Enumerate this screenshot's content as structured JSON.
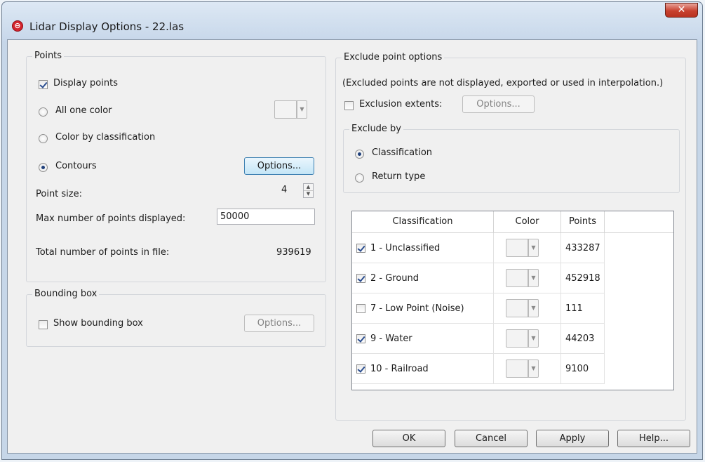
{
  "window": {
    "title": "Lidar Display Options - 22.las",
    "close_label": "✕"
  },
  "points": {
    "group_title": "Points",
    "display_points_label": "Display points",
    "display_points_checked": true,
    "all_one_color_label": "All one color",
    "color_by_classification_label": "Color by classification",
    "contours_label": "Contours",
    "selected_mode": "contours",
    "options_button_label": "Options...",
    "point_size_label": "Point size:",
    "point_size_value": "4",
    "max_points_label": "Max number of points displayed:",
    "max_points_value": "50000",
    "total_points_label": "Total number of points in file:",
    "total_points_value": "939619"
  },
  "bounding_box": {
    "group_title": "Bounding box",
    "show_label": "Show bounding box",
    "show_checked": false,
    "options_button_label": "Options..."
  },
  "exclude": {
    "group_title": "Exclude point options",
    "note": "(Excluded points are not displayed, exported or used in interpolation.)",
    "extents_label": "Exclusion extents:",
    "extents_checked": false,
    "extents_options_label": "Options...",
    "exclude_by_title": "Exclude by",
    "by_classification_label": "Classification",
    "by_return_type_label": "Return type",
    "selected_by": "classification"
  },
  "table": {
    "columns": [
      "Classification",
      "Color",
      "Points"
    ],
    "rows": [
      {
        "label": "1 - Unclassified",
        "checked": true,
        "points": "433287"
      },
      {
        "label": "2 - Ground",
        "checked": true,
        "points": "452918"
      },
      {
        "label": "7 - Low Point (Noise)",
        "checked": false,
        "points": "111"
      },
      {
        "label": "9 - Water",
        "checked": true,
        "points": "44203"
      },
      {
        "label": "10 - Railroad",
        "checked": true,
        "points": "9100"
      }
    ]
  },
  "footer": {
    "ok_label": "OK",
    "cancel_label": "Cancel",
    "apply_label": "Apply",
    "help_label": "Help..."
  },
  "colors": {
    "title_bar": "#c7d7ea",
    "close_button": "#c8412f",
    "dialog_bg": "#f0f0f0",
    "focus_button": "#c4e5f6"
  }
}
